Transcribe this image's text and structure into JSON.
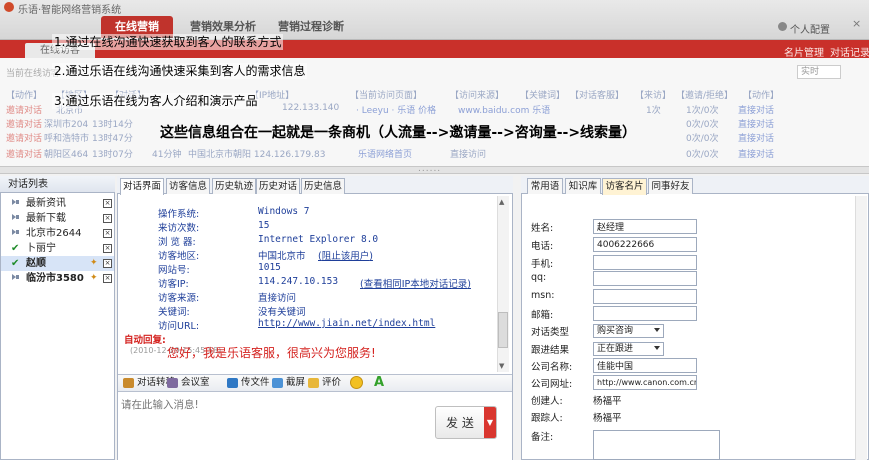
{
  "app": {
    "title": "乐语·智能网络营销系统",
    "nav_tabs": [
      "在线营销",
      "营销效果分析",
      "营销过程诊断"
    ],
    "user_link": "个人配置",
    "close_glyph": "×"
  },
  "subbar": {
    "active_tab": "在线访客",
    "links": [
      "名片管理",
      "对话记录"
    ]
  },
  "visitor_table": {
    "filter_label": "当前在线访客",
    "refresh": "实时",
    "columns": [
      "【动作】",
      "【地区】",
      "【对话】",
      "【IP地址】",
      "【当前访问页面】",
      "【访问来源】",
      "【关键词】",
      "【对话客服】",
      "【来访】",
      "【邀请/拒绝】",
      "【动作】"
    ],
    "rows": [
      [
        "邀请对话",
        "北京市",
        "",
        "",
        "122.133.140",
        "· Leeyu · 乐语 价格",
        "www.baidu.com 乐语",
        "",
        "1次",
        "1次/0次",
        "直接对话"
      ],
      [
        "邀请对话",
        "深圳市204",
        "13时14分",
        "",
        "",
        "",
        "",
        "",
        "",
        "0次/0次",
        "直接对话"
      ],
      [
        "邀请对话",
        "呼和浩特市",
        "13时47分",
        "",
        "",
        "",
        "",
        "",
        "",
        "0次/0次",
        "直接对话"
      ],
      [
        "邀请对话",
        "朝阳区464",
        "13时07分",
        "41分钟",
        "中国北京市朝阳 124.126.179.83",
        "乐语网络首页",
        "直接访问",
        "",
        "",
        "0次/0次",
        "直接对话"
      ]
    ]
  },
  "annotations": {
    "a1": "1.通过在线沟通快速获取到客人的联系方式",
    "a2": "2.通过乐语在线沟通快速采集到客人的需求信息",
    "a3": "3.通过乐语在线为客人介绍和演示产品",
    "main": "这些信息组合在一起就是一条商机（人流量-->邀请量-->咨询量-->线索量）"
  },
  "divider_grip": "......",
  "dialog_list": {
    "title": "对话列表",
    "items": [
      {
        "label": "最新资讯",
        "icon": "speaker-icon",
        "close": "×"
      },
      {
        "label": "最新下载",
        "icon": "speaker-icon",
        "close": "×"
      },
      {
        "label": "北京市2644",
        "icon": "speaker-icon",
        "close": "×"
      },
      {
        "label": "卜丽宁",
        "icon": "check-icon",
        "close": "×"
      },
      {
        "label": "赵顺",
        "icon": "check-icon",
        "close": "×"
      },
      {
        "label": "临汾市3580",
        "icon": "speaker-icon",
        "close": "×"
      }
    ]
  },
  "chat": {
    "tabs": [
      "对话界面",
      "访客信息",
      "历史轨迹",
      "历史对话",
      "历史信息"
    ],
    "info": [
      {
        "k": "操作系统:",
        "v": "Windows 7"
      },
      {
        "k": "来访次数:",
        "v": "15"
      },
      {
        "k": "浏 览 器:",
        "v": "Internet Explorer 8.0"
      },
      {
        "k": "访客地区:",
        "v": "中国北京市"
      },
      {
        "k": "网站号:",
        "v": "1015"
      },
      {
        "k": "访客IP:",
        "v": "114.247.10.153"
      },
      {
        "k": "访客来源:",
        "v": "直接访问"
      },
      {
        "k": "关键词:",
        "v": "没有关键词"
      },
      {
        "k": "访问URL:",
        "v": "http://www.jiain.net/index.html"
      }
    ],
    "block_user": "阻止该用户",
    "same_ip_link": "查看相同IP本地对话记录",
    "auto_reply_label": "自动回复:",
    "auto_reply_time": "(2010-12-29 15:45:58)",
    "auto_reply_msg": "您好，我是乐语客服，很高兴为您服务!",
    "toolbar": [
      "对话转移",
      "会议室",
      "传文件",
      "截屏",
      "评价"
    ],
    "input_placeholder": "请在此输入消息!",
    "send": "发 送",
    "scroll_up": "▲",
    "scroll_down": "▼",
    "send_arrow": "▼"
  },
  "card": {
    "tabs": [
      "常用语",
      "知识库",
      "访客名片",
      "同事好友"
    ],
    "fields": {
      "name_label": "姓名:",
      "name": "赵经理",
      "phone_label": "电话:",
      "phone": "4006222666",
      "mobile_label": "手机:",
      "mobile": "",
      "qq_label": "qq:",
      "qq": "",
      "msn_label": "msn:",
      "msn": "",
      "email_label": "邮箱:",
      "email": "",
      "type_label": "对话类型",
      "type": "购买咨询",
      "follow_label": "跟进结果",
      "follow": "正在跟进",
      "company_label": "公司名称:",
      "company": "佳能中国",
      "website_label": "公司网址:",
      "website": "http://www.canon.com.cn",
      "creator_label": "创建人:",
      "creator": "杨福平",
      "tracker_label": "跟踪人:",
      "tracker": "杨福平",
      "note_label": "备注:"
    }
  },
  "colors": {
    "brand_red": "#c9302a",
    "link_blue": "#1f3f9a",
    "alert_red": "#d4221f"
  }
}
